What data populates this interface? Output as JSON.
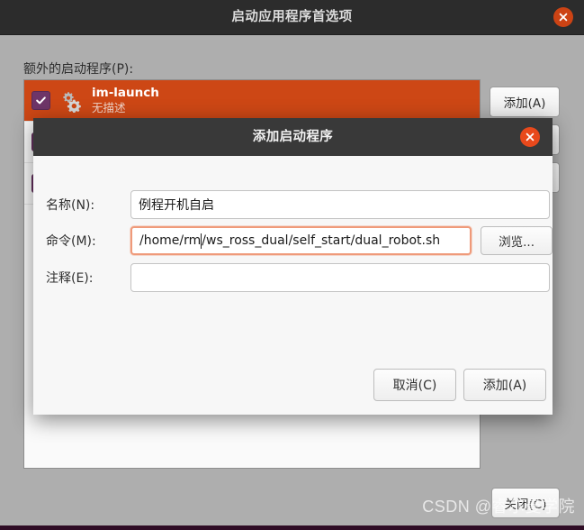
{
  "main_window": {
    "title": "启动应用程序首选项",
    "close_icon": "close-icon",
    "section_label": "额外的启动程序(P):",
    "list": [
      {
        "title": "im-launch",
        "subtitle": "无描述",
        "checked": true,
        "selected": true,
        "icon": "gears-icon"
      },
      {
        "title": "",
        "subtitle": "",
        "checked": true,
        "selected": false,
        "icon": "gears-icon"
      },
      {
        "title": "",
        "subtitle": "",
        "checked": true,
        "selected": false,
        "icon": "gears-icon"
      }
    ],
    "buttons": {
      "add": "添加(A)",
      "remove": "",
      "edit": "",
      "close": "关闭(C)"
    }
  },
  "dialog": {
    "title": "添加启动程序",
    "close_icon": "close-icon",
    "fields": {
      "name_label": "名称(N):",
      "name_value": "例程开机自启",
      "command_label": "命令(M):",
      "command_value_before_caret": "/home/rm",
      "command_value_after_caret": "/ws_ross_dual/self_start/dual_robot.sh",
      "comment_label": "注释(E):",
      "comment_value": "",
      "browse_label": "浏览..."
    },
    "buttons": {
      "cancel": "取消(C)",
      "add": "添加(A)"
    }
  },
  "watermark": "CSDN @睿尔曼学院",
  "colors": {
    "titlebar": "#2c2c2c",
    "dialog_titlebar": "#393939",
    "selection_orange": "#cd4715",
    "close_orange": "#e8491c",
    "checkbox_purple": "#6e3568",
    "window_bg": "#aeaeae",
    "focus_border": "#ef9a7a"
  }
}
